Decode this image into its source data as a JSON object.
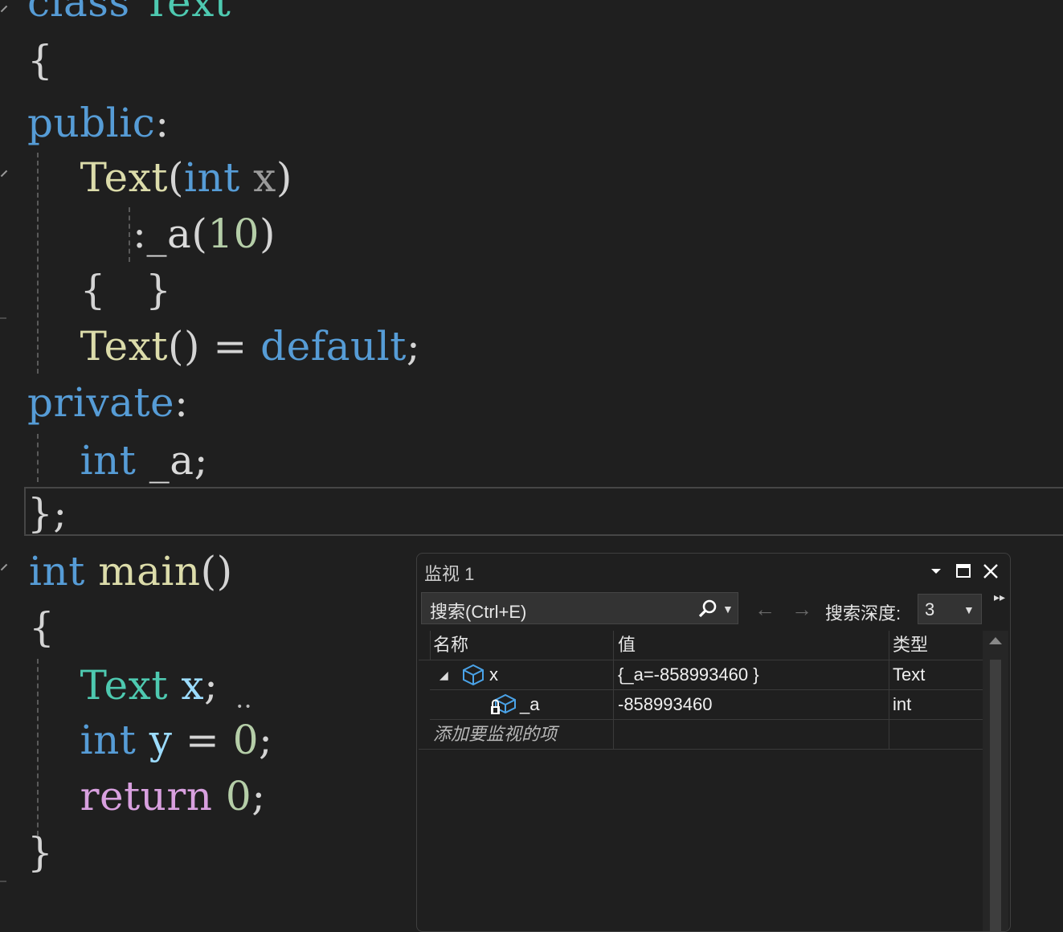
{
  "editor": {
    "lines": [
      {
        "tokens": [
          [
            "kw",
            "class"
          ],
          [
            "pu",
            " "
          ],
          [
            "ty",
            "Text"
          ]
        ]
      },
      {
        "tokens": [
          [
            "pu",
            "{"
          ]
        ]
      },
      {
        "tokens": [
          [
            "kw",
            "public"
          ],
          [
            "pu",
            ":"
          ]
        ]
      },
      {
        "tokens": [
          [
            "pu",
            "    "
          ],
          [
            "fn",
            "Text"
          ],
          [
            "pu",
            "("
          ],
          [
            "kw",
            "int"
          ],
          [
            "pu",
            " "
          ],
          [
            "pa",
            "x"
          ],
          [
            "pu",
            ")"
          ]
        ]
      },
      {
        "tokens": [
          [
            "pu",
            "        :"
          ],
          [
            "mem",
            "_a"
          ],
          [
            "pu",
            "("
          ],
          [
            "nu",
            "10"
          ],
          [
            "pu",
            ")"
          ]
        ]
      },
      {
        "tokens": [
          [
            "pu",
            "    {   }"
          ]
        ]
      },
      {
        "tokens": [
          [
            "pu",
            "    "
          ],
          [
            "fn",
            "Text"
          ],
          [
            "pu",
            "() = "
          ],
          [
            "kw",
            "default"
          ],
          [
            "pu",
            ";"
          ]
        ]
      },
      {
        "tokens": [
          [
            "kw",
            "private"
          ],
          [
            "pu",
            ":"
          ]
        ]
      },
      {
        "tokens": [
          [
            "pu",
            "    "
          ],
          [
            "kw",
            "int"
          ],
          [
            "pu",
            " "
          ],
          [
            "mem",
            "_a"
          ],
          [
            "pu",
            ";"
          ]
        ]
      },
      {
        "tokens": [
          [
            "pu",
            "};"
          ]
        ]
      },
      {
        "tokens": [
          [
            "kw",
            "int"
          ],
          [
            "pu",
            " "
          ],
          [
            "fn",
            "main"
          ],
          [
            "pu",
            "()"
          ]
        ]
      },
      {
        "tokens": [
          [
            "pu",
            "{"
          ]
        ]
      },
      {
        "tokens": [
          [
            "pu",
            "    "
          ],
          [
            "ty",
            "Text"
          ],
          [
            "pu",
            " "
          ],
          [
            "va",
            "x"
          ],
          [
            "pu",
            ";"
          ]
        ]
      },
      {
        "tokens": [
          [
            "pu",
            "    "
          ],
          [
            "kw",
            "int"
          ],
          [
            "pu",
            " "
          ],
          [
            "va",
            "y"
          ],
          [
            "pu",
            " = "
          ],
          [
            "nu",
            "0"
          ],
          [
            "pu",
            ";"
          ]
        ]
      },
      {
        "tokens": [
          [
            "pu",
            "    "
          ],
          [
            "ctl",
            "return"
          ],
          [
            "pu",
            " "
          ],
          [
            "nu",
            "0"
          ],
          [
            "pu",
            ";"
          ]
        ]
      },
      {
        "tokens": [
          [
            "pu",
            "}"
          ]
        ]
      }
    ]
  },
  "watch": {
    "title": "监视 1",
    "search_placeholder": "搜索(Ctrl+E)",
    "depth_label": "搜索深度:",
    "depth_value": "3",
    "columns": {
      "name": "名称",
      "value": "值",
      "type": "类型"
    },
    "rows": [
      {
        "name": "x",
        "value": "{_a=-858993460 }",
        "type": "Text"
      },
      {
        "name": "_a",
        "value": "-858993460",
        "type": "int"
      }
    ],
    "add_item": "添加要监视的项",
    "icons": {
      "dropdown": "chevron-down-icon",
      "maximize": "maximize-icon",
      "close": "close-icon",
      "search": "search-icon",
      "back": "arrow-left-icon",
      "forward": "arrow-right-icon",
      "object": "object-cube-icon",
      "private_field": "private-field-icon"
    }
  }
}
